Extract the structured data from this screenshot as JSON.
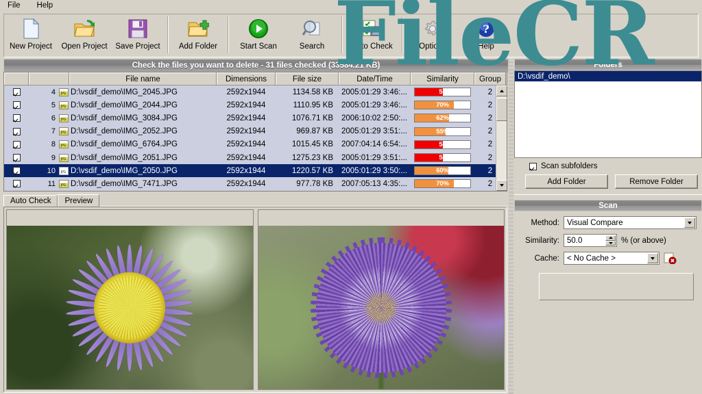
{
  "menu": {
    "items": [
      "File",
      "Help"
    ]
  },
  "toolbar": {
    "buttons": [
      {
        "label": "New Project",
        "icon": "new-document-icon"
      },
      {
        "label": "Open Project",
        "icon": "open-folder-icon"
      },
      {
        "label": "Save Project",
        "icon": "floppy-disk-icon"
      },
      {
        "label": "Add Folder",
        "icon": "add-folder-icon"
      },
      {
        "label": "Start Scan",
        "icon": "green-play-icon"
      },
      {
        "label": "Search",
        "icon": "magnifier-icon"
      },
      {
        "label": "Auto Check",
        "icon": "checklist-image-icon"
      },
      {
        "label": "Options",
        "icon": "gear-icon"
      },
      {
        "label": "Help",
        "icon": "blue-help-icon"
      }
    ]
  },
  "status": {
    "text": "Check the files you want to delete - 31 files checked (33584.21 KB)"
  },
  "file_list": {
    "columns": [
      "",
      "",
      "File name",
      "Dimensions",
      "File size",
      "Date/Time",
      "Similarity",
      "Group"
    ],
    "rows": [
      {
        "checked": true,
        "num": "4",
        "name": "D:\\vsdif_demo\\IMG_2045.JPG",
        "dimensions": "2592x1944",
        "size": "1134.58 KB",
        "date": "2005:01:29 3:46:...",
        "similarity": "51",
        "sim_pct": 51,
        "sim_color": "#f00000",
        "group": "2",
        "selected": false
      },
      {
        "checked": true,
        "num": "5",
        "name": "D:\\vsdif_demo\\IMG_2044.JPG",
        "dimensions": "2592x1944",
        "size": "1110.95 KB",
        "date": "2005:01:29 3:46:...",
        "similarity": "70%",
        "sim_pct": 70,
        "sim_color": "#f2913d",
        "group": "2",
        "selected": false
      },
      {
        "checked": true,
        "num": "6",
        "name": "D:\\vsdif_demo\\IMG_3084.JPG",
        "dimensions": "2592x1944",
        "size": "1076.71 KB",
        "date": "2006:10:02 2:50:...",
        "similarity": "62%",
        "sim_pct": 62,
        "sim_color": "#f2913d",
        "group": "2",
        "selected": false
      },
      {
        "checked": true,
        "num": "7",
        "name": "D:\\vsdif_demo\\IMG_2052.JPG",
        "dimensions": "2592x1944",
        "size": "969.87 KB",
        "date": "2005:01:29 3:51:...",
        "similarity": "55%",
        "sim_pct": 55,
        "sim_color": "#f2913d",
        "group": "2",
        "selected": false
      },
      {
        "checked": true,
        "num": "8",
        "name": "D:\\vsdif_demo\\IMG_6764.JPG",
        "dimensions": "2592x1944",
        "size": "1015.45 KB",
        "date": "2007:04:14 6:54:...",
        "similarity": "50",
        "sim_pct": 50,
        "sim_color": "#f00000",
        "group": "2",
        "selected": false
      },
      {
        "checked": true,
        "num": "9",
        "name": "D:\\vsdif_demo\\IMG_2051.JPG",
        "dimensions": "2592x1944",
        "size": "1275.23 KB",
        "date": "2005:01:29 3:51:...",
        "similarity": "50",
        "sim_pct": 50,
        "sim_color": "#f00000",
        "group": "2",
        "selected": false
      },
      {
        "checked": true,
        "num": "10",
        "name": "D:\\vsdif_demo\\IMG_2050.JPG",
        "dimensions": "2592x1944",
        "size": "1220.57 KB",
        "date": "2005:01:29 3:50:...",
        "similarity": "60%",
        "sim_pct": 60,
        "sim_color": "#f2913d",
        "group": "2",
        "selected": true
      },
      {
        "checked": true,
        "num": "11",
        "name": "D:\\vsdif_demo\\IMG_7471.JPG",
        "dimensions": "2592x1944",
        "size": "977.78 KB",
        "date": "2007:05:13 4:35:...",
        "similarity": "70%",
        "sim_pct": 70,
        "sim_color": "#f2913d",
        "group": "2",
        "selected": false
      }
    ]
  },
  "tabs": {
    "items": [
      "Auto Check",
      "Preview"
    ],
    "active": "Preview"
  },
  "previews": {
    "left": {
      "caption": "",
      "alt": "purple aster flower with yellow center"
    },
    "right": {
      "caption": "",
      "alt": "purple pompom aster flower"
    }
  },
  "folders_panel": {
    "title": "Folders",
    "items": [
      "D:\\vsdif_demo\\"
    ],
    "scan_subfolders_label": "Scan subfolders",
    "scan_subfolders_checked": true,
    "add_folder_label": "Add Folder",
    "remove_folder_label": "Remove Folder"
  },
  "scan_panel": {
    "title": "Scan",
    "method_label": "Method:",
    "method_value": "Visual Compare",
    "similarity_label": "Similarity:",
    "similarity_value": "50.0",
    "similarity_suffix": "% (or above)",
    "cache_label": "Cache:",
    "cache_value": "< No Cache >",
    "clear_cache_icon": "delete-cache-icon"
  },
  "watermark": {
    "text": "FileCR",
    "color": "#3d8c92"
  },
  "colors": {
    "face": "#d6d2c8",
    "selection": "#0a246a",
    "row": "#cbcfe0",
    "header_gradient_dark": "#7e7e7e",
    "bar_red": "#f00000",
    "bar_orange": "#f2913d"
  }
}
